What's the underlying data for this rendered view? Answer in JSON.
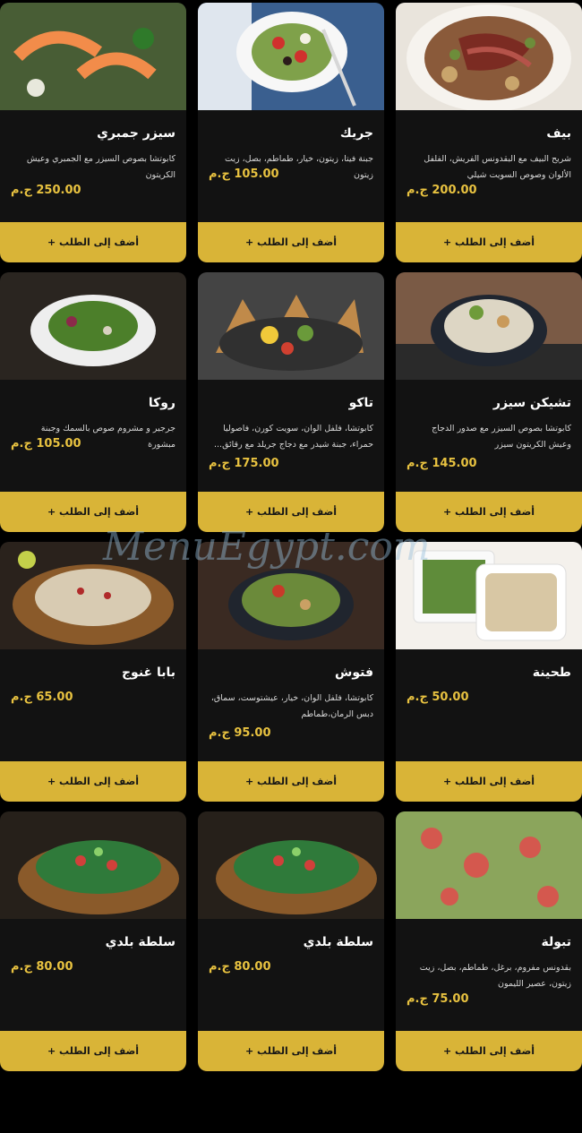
{
  "currency": "ج.م",
  "add_label": "أضف إلى الطلب +",
  "watermark": "MenuEgypt.com",
  "items": [
    {
      "name": "بيف",
      "desc": "شريح البيف مع البقدونس الفريش، الفلفل الألوان وصوص السويت شيلي",
      "price": "200.00 ج.م",
      "photo": "beef"
    },
    {
      "name": "جريك",
      "desc": "جبنة فيتا، زيتون، خيار، طماطم، بصل، زيت زيتون",
      "price": "105.00 ج.م",
      "photo": "greek"
    },
    {
      "name": "سيزر جمبري",
      "desc": "كابوتشا بصوص السيزر مع الجمبري وعيش الكريتون",
      "price": "250.00 ج.م",
      "photo": "shrimp"
    },
    {
      "name": "تشيكن سيزر",
      "desc": "كابوتشا بصوص السيزر مع صدور الدجاج وعيش الكريتون سيزر",
      "price": "145.00 ج.م",
      "photo": "chicken"
    },
    {
      "name": "تاكو",
      "desc": "كابوتشا، فلفل الوان، سويت كورن، فاصوليا حمراء، جبنة شيدر مع دجاج جريلد مع رقائق...",
      "price": "175.00 ج.م",
      "photo": "taco"
    },
    {
      "name": "روكا",
      "desc": "جرجير و مشروم صوص بالسمك وجبنة مبشورة",
      "price": "105.00 ج.م",
      "photo": "roka"
    },
    {
      "name": "طحينة",
      "desc": "",
      "price": "50.00 ج.م",
      "photo": "tahini"
    },
    {
      "name": "فتوش",
      "desc": "كابوتشا، فلفل الوان، خيار، عيشتوست، سماق، دبس الرمان،طماطم",
      "price": "95.00 ج.م",
      "photo": "fattoush"
    },
    {
      "name": "بابا غنوج",
      "desc": "",
      "price": "65.00 ج.م",
      "photo": "baba"
    },
    {
      "name": "تبولة",
      "desc": "بقدونس مفروم، برغل، طماطم، بصل، زيت زيتون، عصير الليمون",
      "price": "75.00 ج.م",
      "photo": "tabbouleh"
    },
    {
      "name": "سلطة بلدي",
      "desc": "",
      "price": "80.00 ج.م",
      "photo": "baladi"
    },
    {
      "name": "سلطة بلدي",
      "desc": "",
      "price": "80.00 ج.م",
      "photo": "baladi"
    }
  ]
}
